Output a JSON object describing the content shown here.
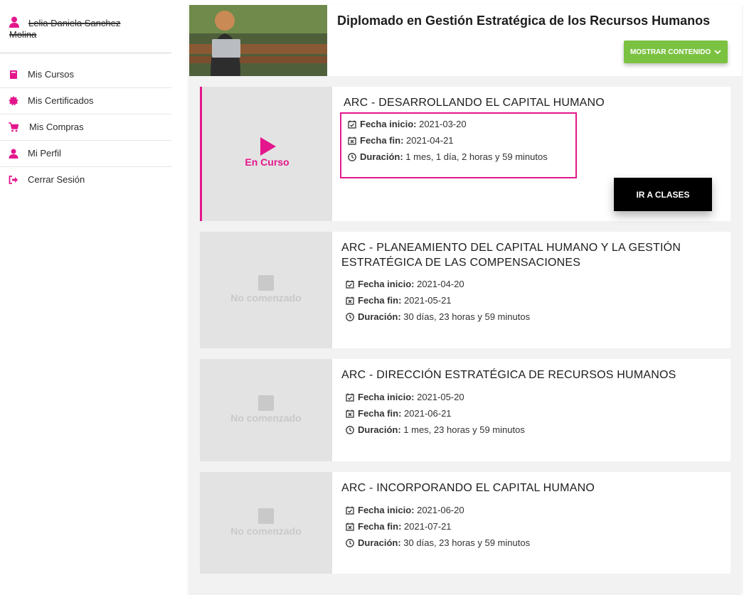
{
  "sidebar": {
    "user_name_line1": "Lelia Daniela Sanchez",
    "user_name_line2": "Molina",
    "items": [
      {
        "label": "Mis Cursos",
        "icon": "book-icon"
      },
      {
        "label": "Mis Certificados",
        "icon": "badge-icon"
      },
      {
        "label": "Mis Compras",
        "icon": "cart-icon"
      },
      {
        "label": "Mi Perfil",
        "icon": "user-icon"
      },
      {
        "label": "Cerrar Sesión",
        "icon": "logout-icon"
      }
    ]
  },
  "program": {
    "title": "Diplomado en Gestión Estratégica de los Recursos Humanos",
    "show_button": "MOSTRAR CONTENIDO"
  },
  "labels": {
    "start": "Fecha inicio:",
    "end": "Fecha fin:",
    "duration": "Duración:"
  },
  "courses": [
    {
      "title": "ARC - DESARROLLANDO EL CAPITAL HUMANO",
      "status": "En Curso",
      "start": "2021-03-20",
      "end": "2021-04-21",
      "duration": "1 mes, 1 día, 2 horas y 59 minutos",
      "button": "IR A CLASES"
    },
    {
      "title": "ARC - PLANEAMIENTO DEL CAPITAL HUMANO Y LA GESTIÓN ESTRATÉGICA DE LAS COMPENSACIONES",
      "status": "No comenzado",
      "start": "2021-04-20",
      "end": "2021-05-21",
      "duration": "30 días, 23 horas y 59 minutos"
    },
    {
      "title": "ARC - DIRECCIÓN ESTRATÉGICA DE RECURSOS HUMANOS",
      "status": "No comenzado",
      "start": "2021-05-20",
      "end": "2021-06-21",
      "duration": "1 mes, 23 horas y 59 minutos"
    },
    {
      "title": "ARC - INCORPORANDO EL CAPITAL HUMANO",
      "status": "No comenzado",
      "start": "2021-06-20",
      "end": "2021-07-21",
      "duration": "30 días, 23 horas y 59 minutos"
    }
  ],
  "colors": {
    "accent": "#e4168c",
    "green": "#7cc242",
    "black_button": "#000000",
    "thumb_bg": "#e3e3e3"
  }
}
